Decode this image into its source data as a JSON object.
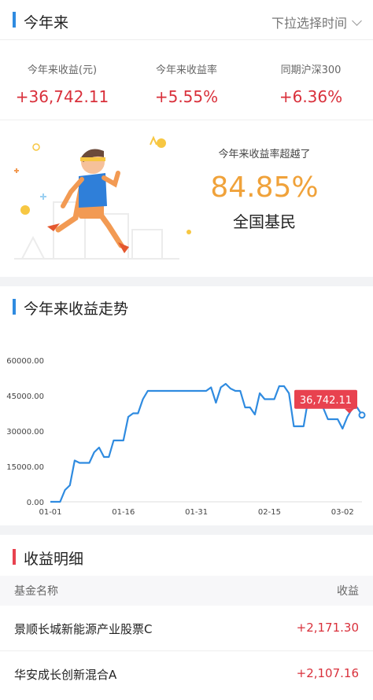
{
  "header": {
    "title": "今年来",
    "dropdown_label": "下拉选择时间"
  },
  "stats": [
    {
      "label": "今年来收益(元)",
      "value": "+36,742.11"
    },
    {
      "label": "今年来收益率",
      "value": "+5.55%"
    },
    {
      "label": "同期沪深300",
      "value": "+6.36%"
    }
  ],
  "ranking": {
    "label": "今年来收益率超越了",
    "percent": "84.85%",
    "group": "全国基民"
  },
  "trend": {
    "title": "今年来收益走势",
    "tooltip": "36,742.11",
    "colors": {
      "line": "#2f8be0",
      "tooltip": "#e8424f"
    }
  },
  "chart_data": {
    "type": "line",
    "title": "今年来收益走势",
    "xlabel": "",
    "ylabel": "",
    "ylim": [
      0,
      60000
    ],
    "yticks": [
      "60000.00",
      "45000.00",
      "30000.00",
      "15000.00",
      "0.00"
    ],
    "xticks": [
      "01-01",
      "01-16",
      "01-31",
      "02-15",
      "03-02"
    ],
    "series": [
      {
        "x": [
          0,
          1,
          2,
          3,
          4,
          5,
          6,
          7,
          8,
          9,
          10,
          11,
          12,
          13,
          14,
          15,
          16,
          17,
          18,
          19,
          20,
          21,
          22,
          23,
          24,
          25,
          26,
          27,
          28,
          29,
          30,
          31,
          32,
          33,
          34,
          35,
          36,
          37,
          38,
          39,
          40,
          41,
          42,
          43,
          44,
          45,
          46,
          47,
          48,
          49,
          50,
          51,
          52,
          53,
          54,
          55,
          56,
          57,
          58,
          59,
          60,
          61,
          62,
          63,
          64
        ],
        "values": [
          0,
          0,
          0,
          5000,
          7000,
          17500,
          16500,
          16500,
          16500,
          21000,
          23000,
          19000,
          19000,
          26000,
          26000,
          26000,
          36000,
          37500,
          37500,
          43500,
          47000,
          47000,
          47000,
          47000,
          47000,
          47000,
          47000,
          47000,
          47000,
          47000,
          47000,
          47000,
          47000,
          48500,
          42000,
          48500,
          50000,
          48000,
          47000,
          47000,
          40000,
          40000,
          37000,
          46000,
          43500,
          43500,
          43500,
          49000,
          49000,
          46000,
          32000,
          32000,
          32000,
          44000,
          44500,
          41000,
          40000,
          35000,
          35000,
          35000,
          31000,
          36000,
          39500,
          40000,
          36742
        ]
      }
    ]
  },
  "details": {
    "title": "收益明细",
    "col_name": "基金名称",
    "col_gain": "收益",
    "rows": [
      {
        "name": "景顺长城新能源产业股票C",
        "gain": "+2,171.30"
      },
      {
        "name": "华安成长创新混合A",
        "gain": "+2,107.16"
      }
    ]
  }
}
